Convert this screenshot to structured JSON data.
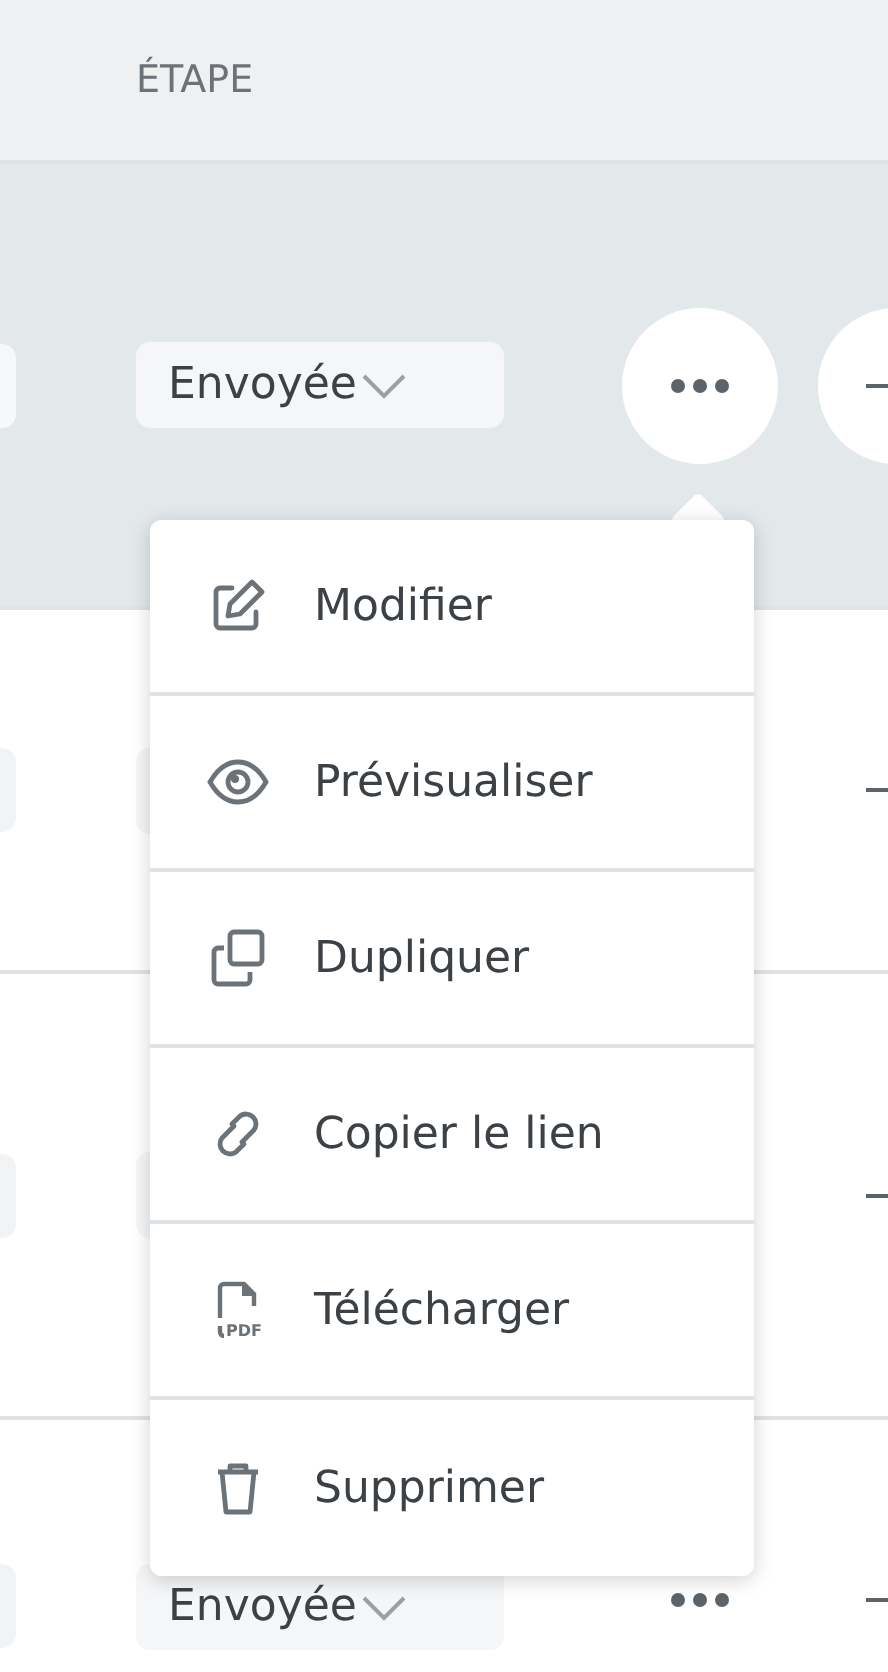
{
  "table": {
    "columns": [
      {
        "label": "ÉTAPE"
      }
    ],
    "rows": [
      {
        "selected": true,
        "stage": "Envoyée"
      },
      {
        "selected": false
      },
      {
        "selected": false
      },
      {
        "selected": false,
        "stage": "Envoyée"
      }
    ]
  },
  "menu": {
    "items": [
      {
        "kind": "edit",
        "label": "Modifier"
      },
      {
        "kind": "preview",
        "label": "Prévisualiser"
      },
      {
        "kind": "duplicate",
        "label": "Dupliquer"
      },
      {
        "kind": "link",
        "label": "Copier le lien"
      },
      {
        "kind": "pdf",
        "label": "Télécharger",
        "icon_text": "PDF"
      },
      {
        "kind": "delete",
        "label": "Supprimer"
      }
    ]
  }
}
